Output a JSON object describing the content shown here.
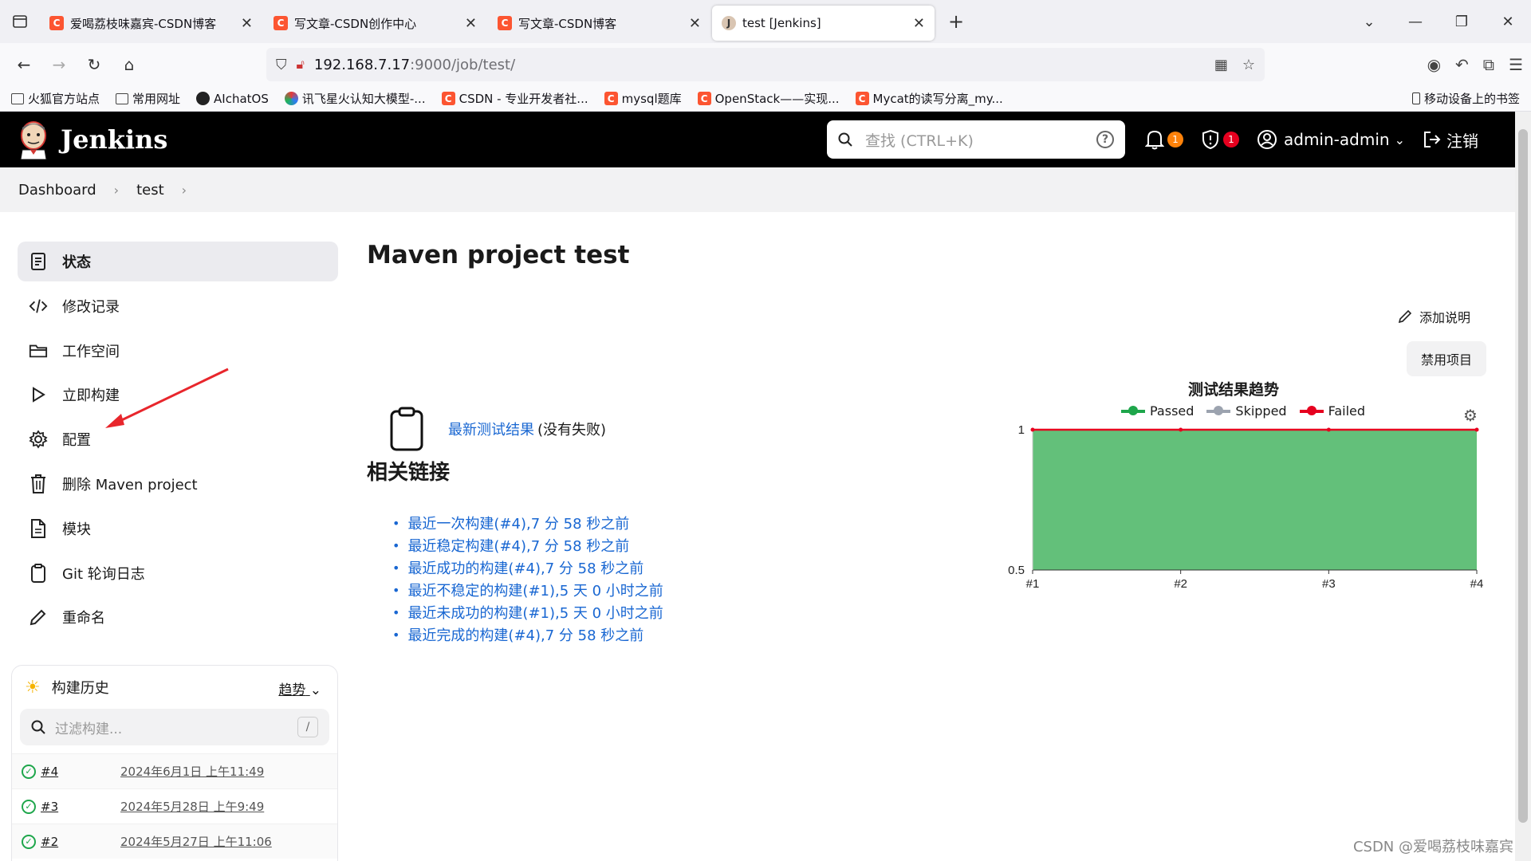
{
  "browser": {
    "tabs": [
      {
        "title": "爱喝荔枝味嘉宾-CSDN博客",
        "icon": "csdn-icon",
        "active": false
      },
      {
        "title": "写文章-CSDN创作中心",
        "icon": "csdn-icon",
        "active": false
      },
      {
        "title": "写文章-CSDN博客",
        "icon": "csdn-icon",
        "active": false
      },
      {
        "title": "test [Jenkins]",
        "icon": "jenkins-icon",
        "active": true
      }
    ],
    "url_host": "192.168.7.17",
    "url_path": ":9000/job/test/",
    "bookmarks": [
      {
        "label": "火狐官方站点",
        "icon": "folder-icon"
      },
      {
        "label": "常用网址",
        "icon": "folder-icon"
      },
      {
        "label": "AIchatOS",
        "icon": "aichatos-icon"
      },
      {
        "label": "讯飞星火认知大模型-...",
        "icon": "xunfei-icon"
      },
      {
        "label": "CSDN - 专业开发者社...",
        "icon": "csdn-icon"
      },
      {
        "label": "mysql题库",
        "icon": "csdn-icon"
      },
      {
        "label": "OpenStack——实现...",
        "icon": "csdn-icon"
      },
      {
        "label": "Mycat的读写分离_my...",
        "icon": "csdn-icon"
      }
    ],
    "mobile_bookmarks": "移动设备上的书签"
  },
  "header": {
    "logo_text": "Jenkins",
    "search_placeholder": "查找 (CTRL+K)",
    "notifications_count": "1",
    "security_count": "1",
    "user": "admin-admin",
    "logout": "注销"
  },
  "breadcrumb": {
    "items": [
      "Dashboard",
      "test"
    ]
  },
  "sidebar": {
    "items": [
      {
        "label": "状态",
        "icon": "status-icon"
      },
      {
        "label": "修改记录",
        "icon": "code-icon"
      },
      {
        "label": "工作空间",
        "icon": "folder-icon"
      },
      {
        "label": "立即构建",
        "icon": "play-icon"
      },
      {
        "label": "配置",
        "icon": "gear-icon"
      },
      {
        "label": "删除 Maven project",
        "icon": "trash-icon"
      },
      {
        "label": "模块",
        "icon": "document-icon"
      },
      {
        "label": "Git 轮询日志",
        "icon": "clipboard-icon"
      },
      {
        "label": "重命名",
        "icon": "pencil-icon"
      }
    ]
  },
  "build_history": {
    "title": "构建历史",
    "trend_label": "趋势",
    "filter_placeholder": "过滤构建...",
    "filter_shortcut": "/",
    "builds": [
      {
        "number": "#4",
        "date": "2024年6月1日 上午11:49"
      },
      {
        "number": "#3",
        "date": "2024年5月28日 上午9:49"
      },
      {
        "number": "#2",
        "date": "2024年5月27日 上午11:06"
      }
    ]
  },
  "main": {
    "title": "Maven project test",
    "add_description": "添加说明",
    "disable_project": "禁用项目",
    "test_result_link": "最新测试结果",
    "test_result_note": "(没有失败)",
    "related_links_title": "相关链接",
    "related_links": [
      "最近一次构建(#4),7 分 58 秒之前",
      "最近稳定构建(#4),7 分 58 秒之前",
      "最近成功的构建(#4),7 分 58 秒之前",
      "最近不稳定的构建(#1),5 天 0 小时之前",
      "最近未成功的构建(#1),5 天 0 小时之前",
      "最近完成的构建(#4),7 分 58 秒之前"
    ]
  },
  "chart_data": {
    "type": "area",
    "title": "测试结果趋势",
    "categories": [
      "#1",
      "#2",
      "#3",
      "#4"
    ],
    "series": [
      {
        "name": "Passed",
        "color": "#1ea64b",
        "values": [
          1,
          1,
          1,
          1
        ]
      },
      {
        "name": "Skipped",
        "color": "#9ca3af",
        "values": [
          0,
          0,
          0,
          0
        ]
      },
      {
        "name": "Failed",
        "color": "#e6001f",
        "values": [
          0,
          0,
          0,
          0
        ]
      }
    ],
    "ylim": [
      0.5,
      1
    ],
    "yticks": [
      "1",
      "0.5"
    ],
    "legend": "top"
  },
  "watermark": "CSDN @爱喝荔枝味嘉宾"
}
